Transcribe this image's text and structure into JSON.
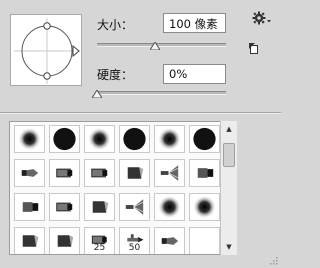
{
  "size": {
    "label": "大小：",
    "value": "100 像素",
    "slider_percent": 45
  },
  "hardness": {
    "label": "硬度：",
    "value": "0%",
    "slider_percent": 0
  },
  "icons": {
    "gear": "gear-icon",
    "new_preset": "new-preset-icon",
    "scroll_up": "▲",
    "scroll_down": "▼"
  },
  "brush_tiles": [
    {
      "kind": "soft-round",
      "size_label": ""
    },
    {
      "kind": "hard-round",
      "size_label": ""
    },
    {
      "kind": "soft-round",
      "size_label": ""
    },
    {
      "kind": "hard-round",
      "size_label": ""
    },
    {
      "kind": "soft-round",
      "size_label": ""
    },
    {
      "kind": "hard-round",
      "size_label": ""
    },
    {
      "kind": "tool-pen",
      "size_label": ""
    },
    {
      "kind": "tool-marker",
      "size_label": ""
    },
    {
      "kind": "tool-marker",
      "size_label": ""
    },
    {
      "kind": "tool-chisel",
      "size_label": ""
    },
    {
      "kind": "tool-fan",
      "size_label": ""
    },
    {
      "kind": "tool-flat",
      "size_label": ""
    },
    {
      "kind": "tool-flat",
      "size_label": ""
    },
    {
      "kind": "tool-marker",
      "size_label": ""
    },
    {
      "kind": "tool-chisel",
      "size_label": ""
    },
    {
      "kind": "tool-fan",
      "size_label": ""
    },
    {
      "kind": "soft-round",
      "size_label": ""
    },
    {
      "kind": "soft-round",
      "size_label": ""
    },
    {
      "kind": "tool-chisel",
      "size_label": ""
    },
    {
      "kind": "tool-chisel",
      "size_label": ""
    },
    {
      "kind": "tool-marker",
      "size_label": "25"
    },
    {
      "kind": "tool-airbrush",
      "size_label": "50"
    },
    {
      "kind": "tool-pen",
      "size_label": ""
    },
    {
      "kind": "",
      "size_label": ""
    }
  ],
  "colors": {
    "panel_bg": "#d6d6d6",
    "tile_bg": "#ffffff",
    "brush_dark": "#111111"
  }
}
